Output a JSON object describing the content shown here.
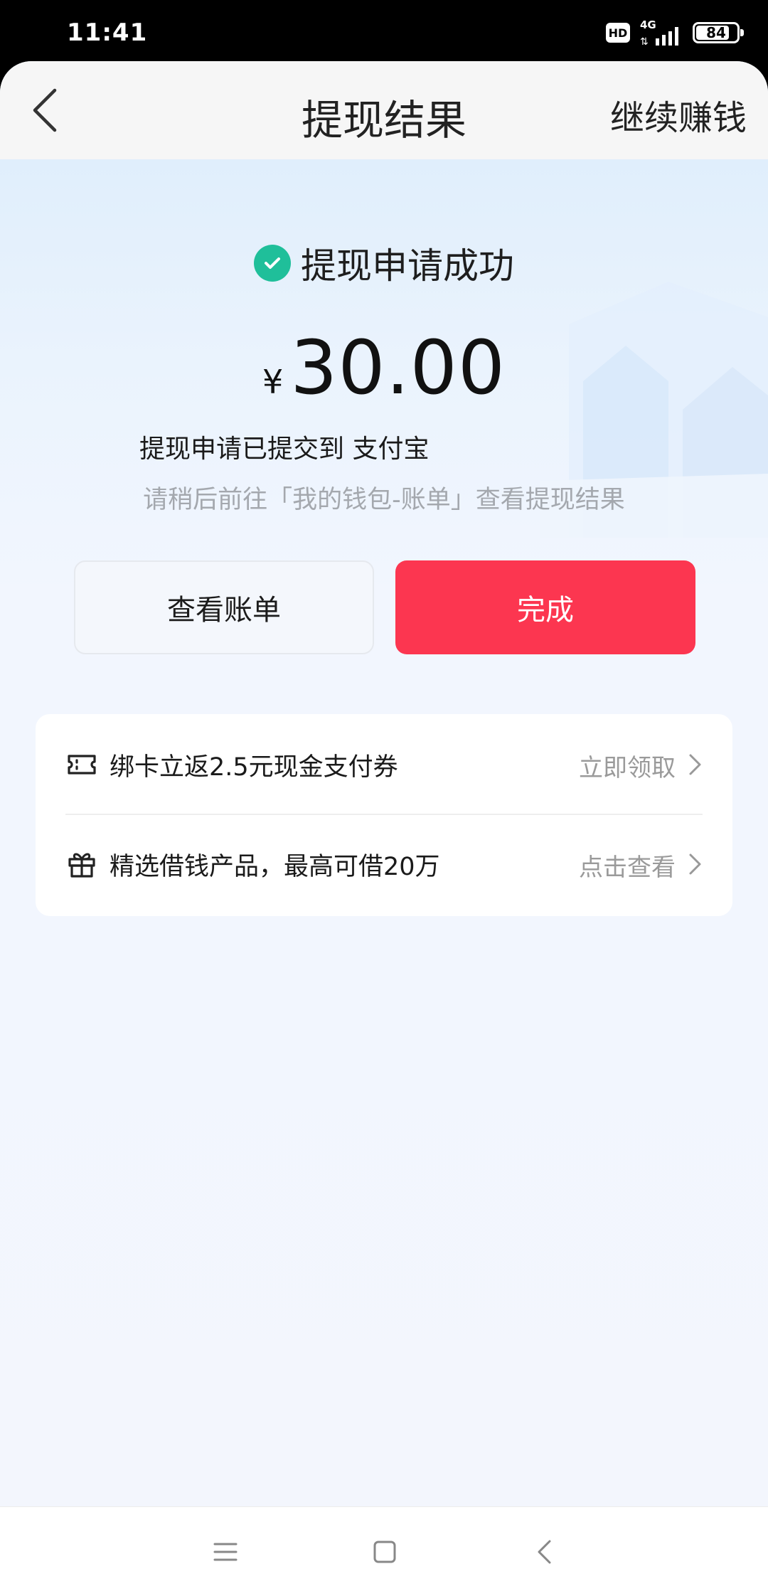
{
  "status_bar": {
    "time": "11:41",
    "hd": "HD",
    "network": "4G",
    "network_arrows": "⇅",
    "battery": "84",
    "battery_level": 0.84
  },
  "nav": {
    "title": "提现结果",
    "right_action": "继续赚钱",
    "back_icon": "chevron-left-icon"
  },
  "result": {
    "status": "提现申请成功",
    "currency": "¥",
    "amount": "30.00",
    "submitted": "提现申请已提交到 支付宝",
    "hint": "请稍后前往「我的钱包-账单」查看提现结果"
  },
  "buttons": {
    "view_bill": "查看账单",
    "done": "完成"
  },
  "promos": [
    {
      "icon": "ticket-icon",
      "text": "绑卡立返2.5元现金支付券",
      "action": "立即领取"
    },
    {
      "icon": "gift-icon",
      "text": "精选借钱产品，最高可借20万",
      "action": "点击查看"
    }
  ],
  "colors": {
    "accent": "#fc3650",
    "success": "#1fbf9a",
    "muted": "#9a9a9a"
  },
  "system_nav": {
    "menu_icon": "menu-icon",
    "home_icon": "home-square-icon",
    "back_icon": "back-arrow-icon"
  }
}
